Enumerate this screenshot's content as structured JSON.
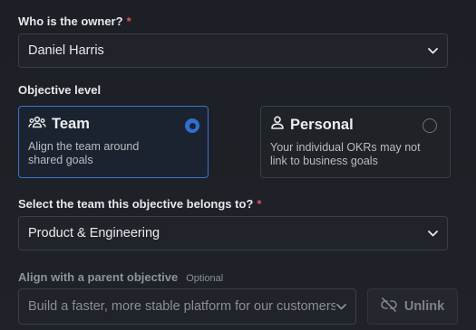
{
  "owner": {
    "label": "Who is the owner?",
    "required_mark": "*",
    "value": "Daniel Harris",
    "chevron_icon": "chevron-down-icon"
  },
  "objective_level": {
    "label": "Objective level",
    "options": [
      {
        "title": "Team",
        "icon": "team-icon",
        "description_line1": "Align the team around",
        "description_line2": "shared goals",
        "selected": true
      },
      {
        "title": "Personal",
        "icon": "person-icon",
        "description_line1": "Your individual OKRs may not",
        "description_line2": "link to business goals",
        "selected": false
      }
    ]
  },
  "team": {
    "label": "Select the team this objective belongs to?",
    "required_mark": "*",
    "value": "Product & Engineering",
    "chevron_icon": "chevron-down-icon"
  },
  "parent_objective": {
    "label": "Align with a parent objective",
    "optional_tag": "Optional",
    "value": "Build a faster, more stable platform for our customers",
    "chevron_icon": "chevron-down-icon",
    "unlink_label": "Unlink",
    "unlink_icon": "unlink-icon"
  },
  "colors": {
    "accent": "#2f6fd0",
    "required": "#e0505a",
    "background": "#1e2127"
  }
}
